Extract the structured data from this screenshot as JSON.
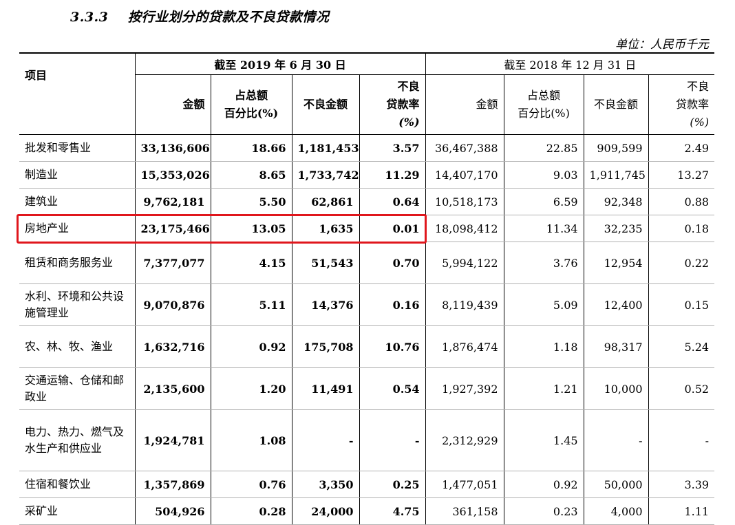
{
  "section": {
    "number": "3.3.3",
    "title": "按行业划分的贷款及不良贷款情况"
  },
  "unit": "单位：人民币千元",
  "headers": {
    "item": "项目",
    "period1": "截至 2019 年 6 月 30 日",
    "period2": "截至 2018 年 12 月 31 日",
    "amount": "金额",
    "share_line1": "占总额",
    "share_line2": "百分比(%)",
    "npl_amount": "不良金额",
    "npl_rate_line1": "不良",
    "npl_rate_line2": "贷款率",
    "npl_rate_line3": "(%)"
  },
  "rows": [
    {
      "item": "批发和零售业",
      "a1": "33,136,606",
      "s1": "18.66",
      "n1": "1,181,453",
      "r1": "3.57",
      "a2": "36,467,388",
      "s2": "22.85",
      "n2": "909,599",
      "r2": "2.49"
    },
    {
      "item": "制造业",
      "a1": "15,353,026",
      "s1": "8.65",
      "n1": "1,733,742",
      "r1": "11.29",
      "a2": "14,407,170",
      "s2": "9.03",
      "n2": "1,911,745",
      "r2": "13.27"
    },
    {
      "item": "建筑业",
      "a1": "9,762,181",
      "s1": "5.50",
      "n1": "62,861",
      "r1": "0.64",
      "a2": "10,518,173",
      "s2": "6.59",
      "n2": "92,348",
      "r2": "0.88"
    },
    {
      "item": "房地产业",
      "a1": "23,175,466",
      "s1": "13.05",
      "n1": "1,635",
      "r1": "0.01",
      "a2": "18,098,412",
      "s2": "11.34",
      "n2": "32,235",
      "r2": "0.18"
    },
    {
      "item": "租赁和商务服务业",
      "a1": "7,377,077",
      "s1": "4.15",
      "n1": "51,543",
      "r1": "0.70",
      "a2": "5,994,122",
      "s2": "3.76",
      "n2": "12,954",
      "r2": "0.22"
    },
    {
      "item": "水利、环境和公共设施管理业",
      "a1": "9,070,876",
      "s1": "5.11",
      "n1": "14,376",
      "r1": "0.16",
      "a2": "8,119,439",
      "s2": "5.09",
      "n2": "12,400",
      "r2": "0.15"
    },
    {
      "item": "农、林、牧、渔业",
      "a1": "1,632,716",
      "s1": "0.92",
      "n1": "175,708",
      "r1": "10.76",
      "a2": "1,876,474",
      "s2": "1.18",
      "n2": "98,317",
      "r2": "5.24"
    },
    {
      "item": "交通运输、仓储和邮政业",
      "a1": "2,135,600",
      "s1": "1.20",
      "n1": "11,491",
      "r1": "0.54",
      "a2": "1,927,392",
      "s2": "1.21",
      "n2": "10,000",
      "r2": "0.52"
    },
    {
      "item": "电力、热力、燃气及水生产和供应业",
      "a1": "1,924,781",
      "s1": "1.08",
      "n1": "-",
      "r1": "-",
      "a2": "2,312,929",
      "s2": "1.45",
      "n2": "-",
      "r2": "-"
    },
    {
      "item": "住宿和餐饮业",
      "a1": "1,357,869",
      "s1": "0.76",
      "n1": "3,350",
      "r1": "0.25",
      "a2": "1,477,051",
      "s2": "0.92",
      "n2": "50,000",
      "r2": "3.39"
    },
    {
      "item": "采矿业",
      "a1": "504,926",
      "s1": "0.28",
      "n1": "24,000",
      "r1": "4.75",
      "a2": "361,158",
      "s2": "0.23",
      "n2": "4,000",
      "r2": "1.11"
    }
  ]
}
